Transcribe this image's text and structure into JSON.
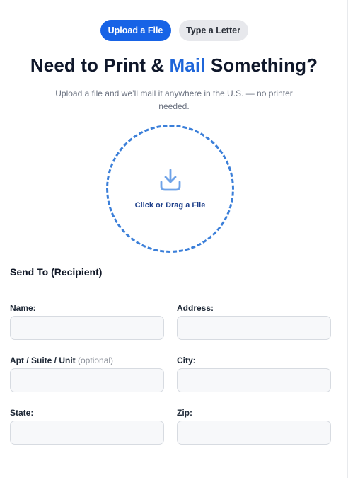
{
  "mode_toggle": {
    "upload_label": "Upload a File",
    "type_label": "Type a Letter"
  },
  "hero": {
    "title_start": "Need to Print & ",
    "title_accent": "Mail",
    "title_end": " Something?",
    "subtitle": "Upload a file and we’ll mail it anywhere in the U.S. — no printer needed."
  },
  "dropzone": {
    "label": "Click or Drag a File",
    "icon": "download-tray-icon"
  },
  "recipient_form": {
    "section_title": "Send To (Recipient)",
    "fields": {
      "name": {
        "label": "Name:",
        "value": ""
      },
      "address": {
        "label": "Address:",
        "value": ""
      },
      "apt": {
        "label": "Apt / Suite / Unit",
        "optional": "(optional)",
        "value": ""
      },
      "city": {
        "label": "City:",
        "value": ""
      },
      "state": {
        "label": "State:",
        "value": ""
      },
      "zip": {
        "label": "Zip:",
        "value": ""
      }
    }
  },
  "colors": {
    "primary": "#1763e6",
    "accent_text": "#1f66d9",
    "dropzone_border": "#3b7fd9",
    "icon": "#6fa3e8"
  }
}
